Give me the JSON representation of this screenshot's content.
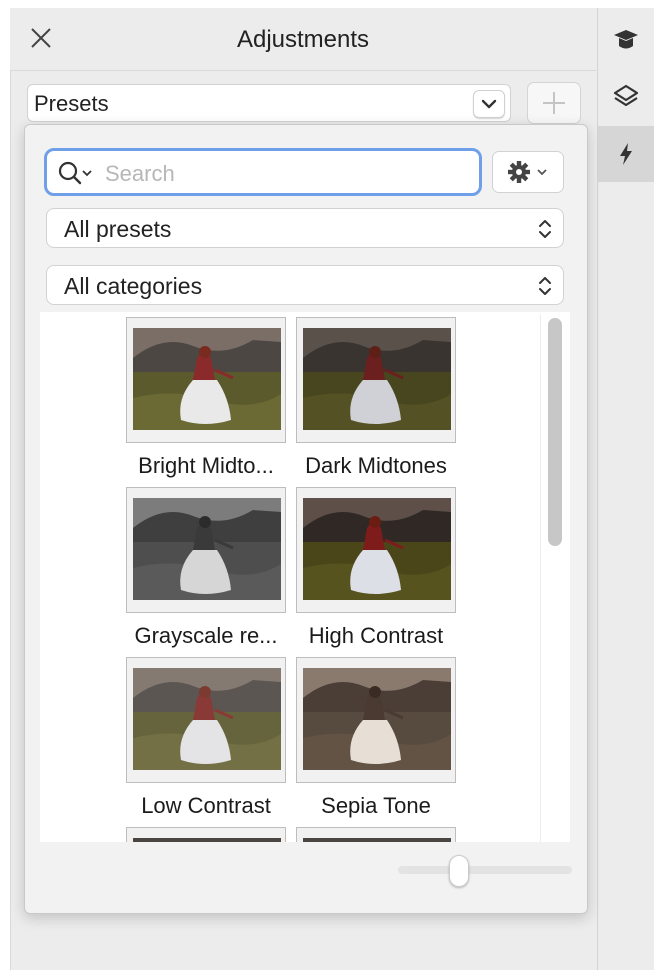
{
  "header": {
    "title": "Adjustments",
    "close_icon": "close-icon"
  },
  "presets_menu": {
    "label": "Presets",
    "chevron_icon": "chevron-down-icon",
    "add_icon": "plus-icon"
  },
  "search": {
    "placeholder": "Search",
    "search_icon": "search-icon",
    "options_icon": "gear-icon"
  },
  "filters": {
    "presets_filter": "All presets",
    "categories_filter": "All categories"
  },
  "presets": [
    {
      "label": "Bright Midto...",
      "style": "bright"
    },
    {
      "label": "Dark Midtones",
      "style": "dark"
    },
    {
      "label": "Grayscale re...",
      "style": "gray"
    },
    {
      "label": "High Contrast",
      "style": "high"
    },
    {
      "label": "Low Contrast",
      "style": "low"
    },
    {
      "label": "Sepia Tone",
      "style": "sepia"
    }
  ],
  "side_panel": {
    "tabs": [
      {
        "icon": "graduation-cap-icon",
        "active": false
      },
      {
        "icon": "layers-icon",
        "active": false
      },
      {
        "icon": "lightning-icon",
        "active": true
      }
    ]
  },
  "colors": {
    "focus_ring": "#6f9fe8",
    "panel_bg": "#ececec"
  }
}
